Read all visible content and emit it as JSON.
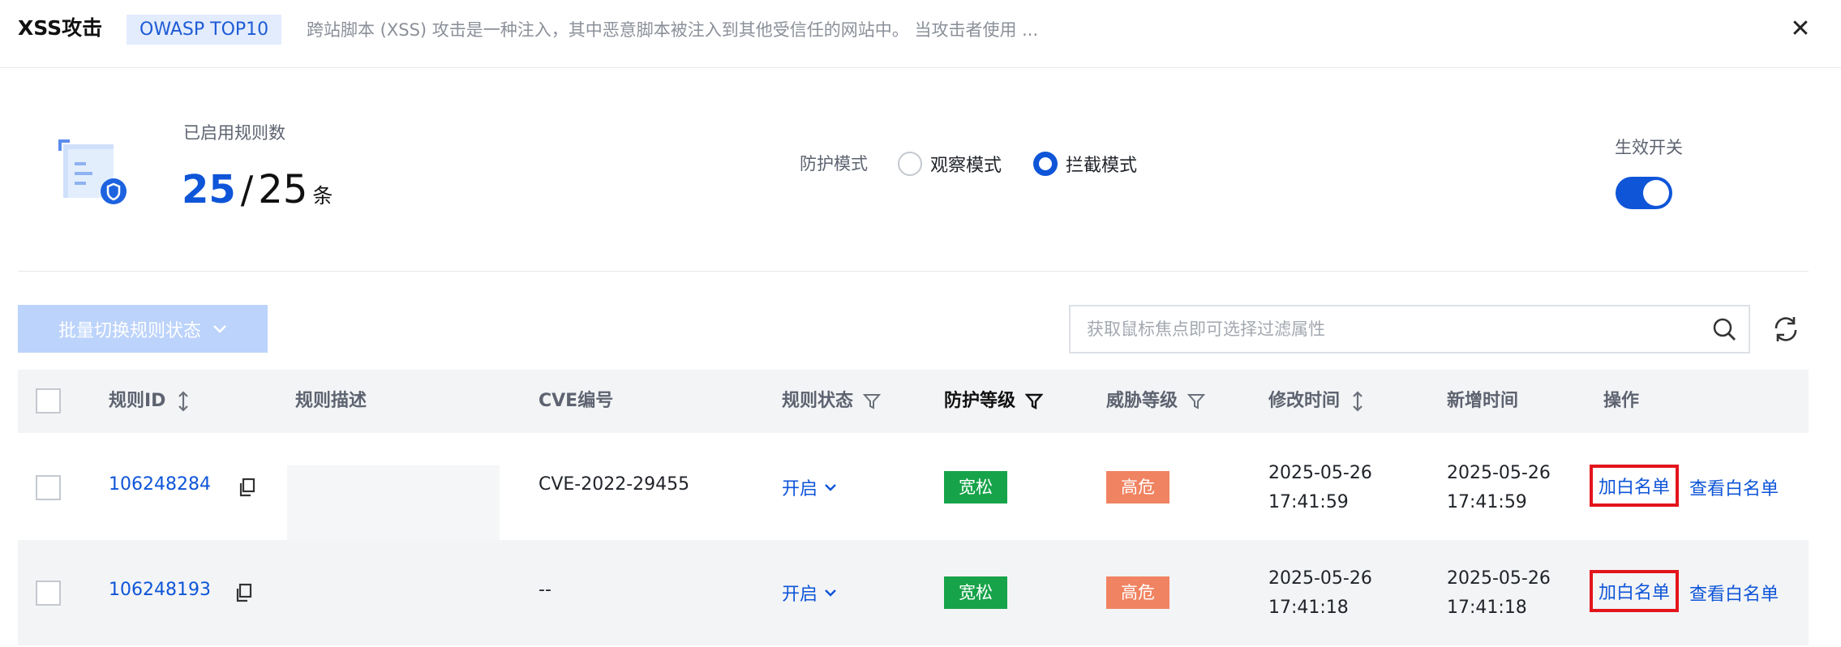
{
  "header": {
    "title": "XSS攻击",
    "tag": "OWASP TOP10",
    "description": "跨站脚本 (XSS) 攻击是一种注入，其中恶意脚本被注入到其他受信任的网站中。 当攻击者使用 ...",
    "close_symbol": "✕"
  },
  "summary": {
    "rules_label": "已启用规则数",
    "enabled_count": "25",
    "separator": "/",
    "total_count": "25",
    "unit": "条",
    "mode_label": "防护模式",
    "modes": [
      {
        "label": "观察模式",
        "selected": false
      },
      {
        "label": "拦截模式",
        "selected": true
      }
    ],
    "switch_label": "生效开关",
    "switch_on": true
  },
  "toolbar": {
    "bulk_button": "批量切换规则状态",
    "search_placeholder": "获取鼠标焦点即可选择过滤属性"
  },
  "table": {
    "columns": {
      "rule_id": "规则ID",
      "description": "规则描述",
      "cve": "CVE编号",
      "status": "规则状态",
      "protection_level": "防护等级",
      "threat_level": "威胁等级",
      "modified_time": "修改时间",
      "added_time": "新增时间",
      "actions": "操作"
    },
    "rows": [
      {
        "rule_id": "106248284",
        "cve": "CVE-2022-29455",
        "status": "开启",
        "protection_level": "宽松",
        "threat_level": "高危",
        "modified_time": "2025-05-26 17:41:59",
        "added_time": "2025-05-26 17:41:59",
        "action_add": "加白名单",
        "action_view": "查看白名单"
      },
      {
        "rule_id": "106248193",
        "cve": "--",
        "status": "开启",
        "protection_level": "宽松",
        "threat_level": "高危",
        "modified_time": "2025-05-26 17:41:18",
        "added_time": "2025-05-26 17:41:18",
        "action_add": "加白名单",
        "action_view": "查看白名单"
      }
    ]
  },
  "colors": {
    "primary": "#0e55d8",
    "tag_bg": "#e3ecfd",
    "badge_green": "#17a34a",
    "badge_orange": "#f08361",
    "highlight_box": "#e3151c"
  },
  "icons": {
    "rule_doc": "document-shield-icon",
    "search": "search-icon",
    "refresh": "refresh-icon",
    "copy": "copy-icon",
    "sort": "sort-icon",
    "filter": "filter-icon",
    "chevron": "chevron-down-icon",
    "close": "close-icon"
  }
}
